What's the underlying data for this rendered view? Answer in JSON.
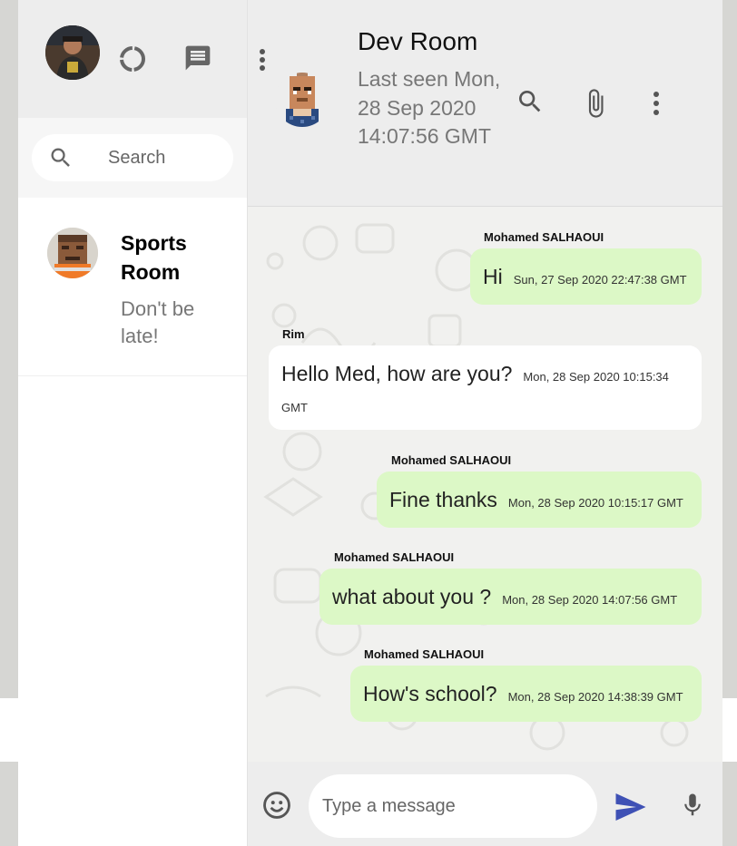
{
  "sidebar": {
    "search": {
      "placeholder": "Search"
    },
    "chats": [
      {
        "name": "Sports Room",
        "last_message": "Don't be late!"
      }
    ]
  },
  "room": {
    "title": "Dev Room",
    "status": "Last seen Mon, 28 Sep 2020 14:07:56 GMT"
  },
  "messages": [
    {
      "sender": "Mohamed SALHAOUI",
      "text": "Hi",
      "timestamp": "Sun, 27 Sep 2020 22:47:38 GMT",
      "sent": true
    },
    {
      "sender": "Rim",
      "text": "Hello Med, how are you?",
      "timestamp": "Mon, 28 Sep 2020 10:15:34 GMT",
      "sent": false
    },
    {
      "sender": "Mohamed SALHAOUI",
      "text": "Fine thanks",
      "timestamp": "Mon, 28 Sep 2020 10:15:17 GMT",
      "sent": true
    },
    {
      "sender": "Mohamed SALHAOUI",
      "text": "what about you ?",
      "timestamp": "Mon, 28 Sep 2020 14:07:56 GMT",
      "sent": true
    },
    {
      "sender": "Mohamed SALHAOUI",
      "text": "How's school?",
      "timestamp": "Mon, 28 Sep 2020 14:38:39 GMT",
      "sent": true
    }
  ],
  "composer": {
    "placeholder": "Type a message"
  },
  "icons": {
    "status": "status-icon",
    "new_chat": "chat-icon",
    "menu": "more-vert-icon",
    "search": "search-icon",
    "attach": "attach-icon",
    "emoji": "emoji-icon",
    "send": "send-icon",
    "mic": "mic-icon"
  },
  "colors": {
    "sent_bubble": "#dcf8c6",
    "received_bubble": "#ffffff",
    "send_button": "#3f51b5",
    "header_bg": "#ededed"
  }
}
